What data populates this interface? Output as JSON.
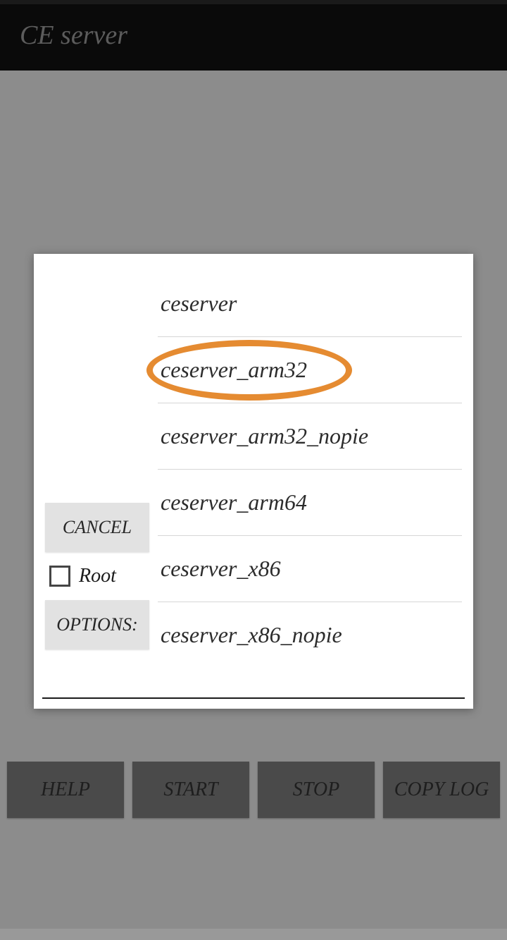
{
  "header": {
    "title": "CE server"
  },
  "dialog": {
    "left": {
      "cancel_label": "CANCEL",
      "root_label": "Root",
      "options_label": "OPTIONS:"
    },
    "options": [
      {
        "label": "ceserver"
      },
      {
        "label": "ceserver_arm32",
        "highlighted": true
      },
      {
        "label": "ceserver_arm32_nopie"
      },
      {
        "label": "ceserver_arm64"
      },
      {
        "label": "ceserver_x86"
      },
      {
        "label": "ceserver_x86_nopie"
      }
    ]
  },
  "bottom": {
    "help_label": "HELP",
    "start_label": "START",
    "stop_label": "STOP",
    "copy_log_label": "COPY LOG"
  },
  "annotation": {
    "circled_option_index": 1,
    "color": "#e58b31"
  }
}
